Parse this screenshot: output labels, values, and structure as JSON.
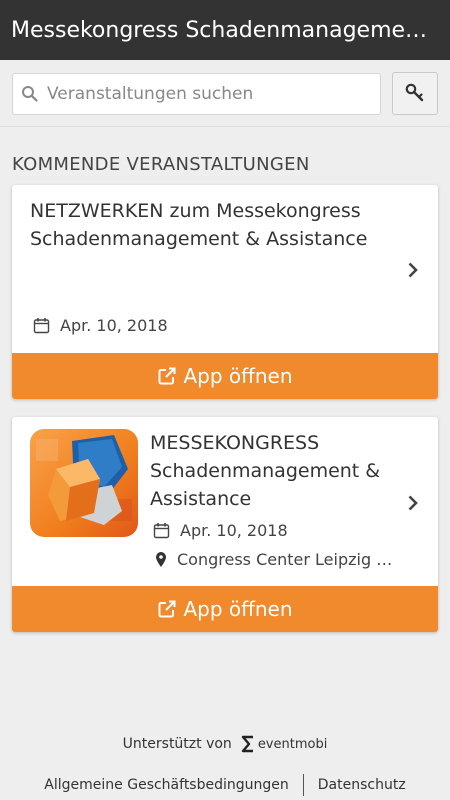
{
  "header": {
    "title": "Messekongress Schadenmanagement..."
  },
  "search": {
    "placeholder": "Veranstaltungen suchen",
    "value": ""
  },
  "section": {
    "title": "KOMMENDE VERANSTALTUNGEN"
  },
  "events": [
    {
      "title": "NETZWERKEN zum Messekongress Schadenmanagement & Assistance",
      "date": "Apr. 10, 2018",
      "open_label": "App öffnen"
    },
    {
      "title": "MESSEKONGRESS Schadenmanagement & Assistance",
      "date": "Apr. 10, 2018",
      "location": "Congress Center Leipzig M...",
      "open_label": "App öffnen"
    }
  ],
  "footer": {
    "supported_by": "Unterstützt von",
    "brand": "eventmobi",
    "terms": "Allgemeine Geschäftsbedingungen",
    "privacy": "Datenschutz"
  },
  "colors": {
    "appbar": "#333333",
    "accent": "#f08a2c",
    "background": "#eeeeee",
    "logo_blue": "#1f5fa8",
    "logo_orange": "#f07d1c"
  },
  "icons": [
    "search-icon",
    "key-icon",
    "calendar-icon",
    "map-pin-icon",
    "chevron-right-icon",
    "external-link-icon",
    "eventmobi-logo"
  ]
}
